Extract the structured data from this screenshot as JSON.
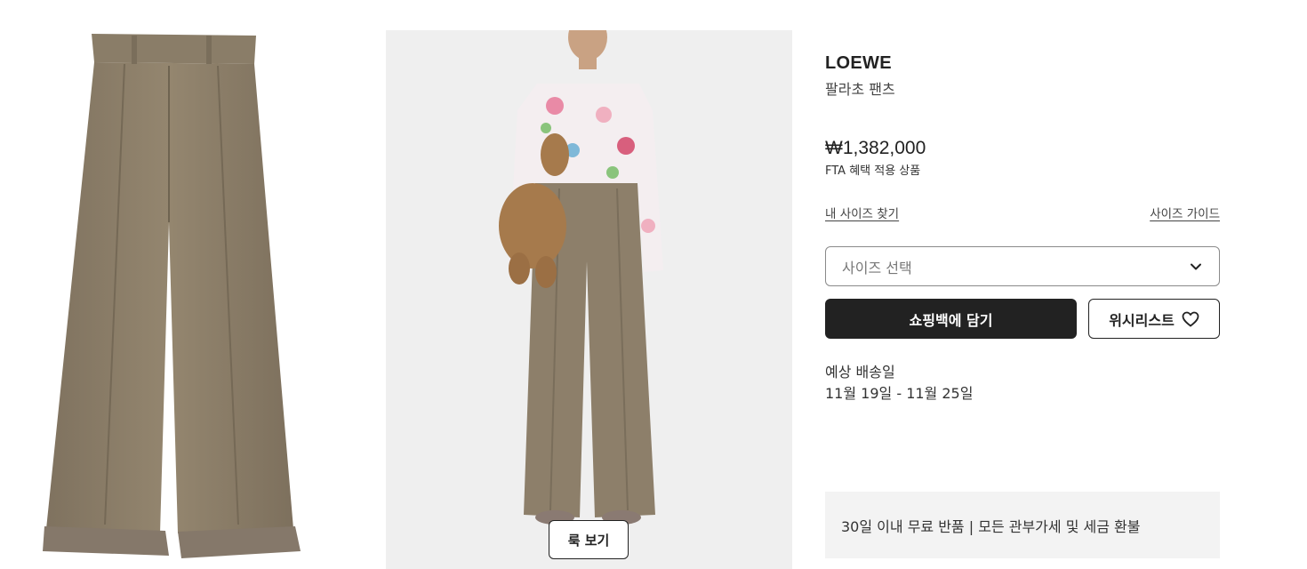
{
  "product": {
    "brand": "LOEWE",
    "name": "팔라초 팬츠",
    "price": "₩1,382,000",
    "price_note": "FTA 혜택 적용 상품"
  },
  "links": {
    "find_size": "내 사이즈 찾기",
    "size_guide": "사이즈 가이드"
  },
  "size_select": {
    "placeholder": "사이즈 선택",
    "icon": "chevron-down-icon"
  },
  "actions": {
    "add_to_bag": "쇼핑백에 담기",
    "wishlist": "위시리스트",
    "wishlist_icon": "heart-icon"
  },
  "delivery": {
    "label": "예상 배송일",
    "dates": "11월 19일 - 11월 25일"
  },
  "gallery": {
    "look_button": "룩 보기"
  },
  "returns": {
    "text": "30일 이내 무료 반품 | 모든 관부가세 및 세금 환불"
  },
  "colors": {
    "trouser": "#8d7f6a",
    "primary_button": "#222222",
    "image_background": "#efefef"
  }
}
